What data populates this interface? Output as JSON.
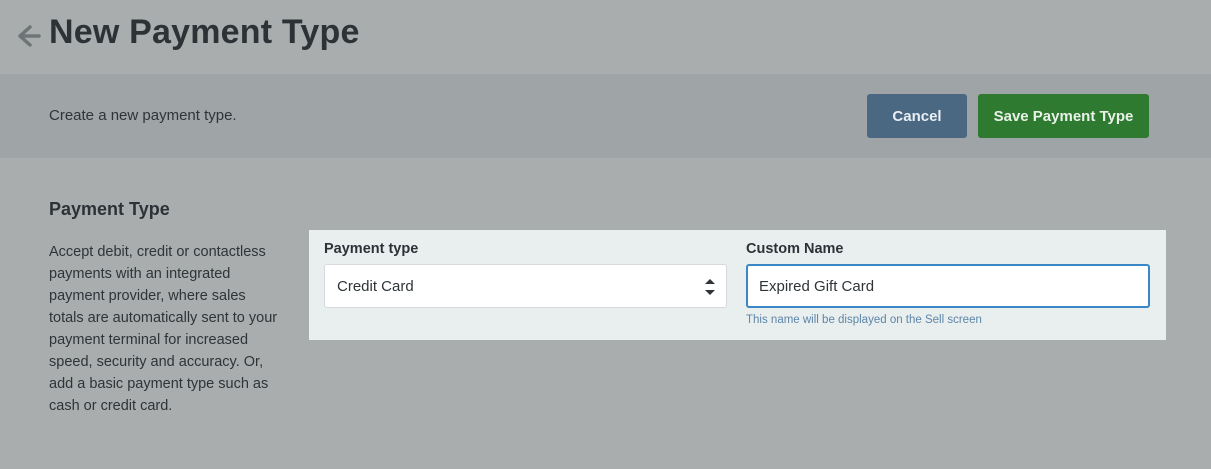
{
  "header": {
    "title": "New Payment Type",
    "back_icon": "arrow-left-icon"
  },
  "action_bar": {
    "description": "Create a new payment type.",
    "cancel_label": "Cancel",
    "save_label": "Save Payment Type"
  },
  "section": {
    "heading": "Payment Type",
    "description": "Accept debit, credit or contactless payments with an integrated payment provider, where sales totals are automatically sent to your payment terminal for increased speed, security and accuracy. Or, add a basic payment type such as cash or credit card."
  },
  "form": {
    "payment_type_label": "Payment type",
    "payment_type_value": "Credit Card",
    "custom_name_label": "Custom Name",
    "custom_name_value": "Expired Gift Card",
    "custom_name_hint": "This name will be displayed on the Sell screen"
  },
  "colors": {
    "cancel_button": "#4b6882",
    "save_button": "#2f7a31",
    "focus_border": "#3a87c7"
  }
}
